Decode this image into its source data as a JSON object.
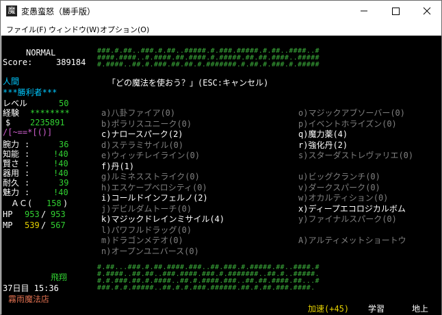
{
  "window": {
    "title": "変愚蛮怒（勝手版）",
    "icon": "app-icon"
  },
  "menu": {
    "items": [
      "ファイル(F)",
      "ウィンドウ(W)",
      "オプション(O)"
    ]
  },
  "sidebar": {
    "difficulty": "NORMAL",
    "score_label": "Score:",
    "score": "389184",
    "race": "人間",
    "title": "***勝利者***",
    "level_label": "レベル",
    "level": "50",
    "exp_label": "経験",
    "exp": "********",
    "gold_label": "$",
    "gold": "2235891",
    "equip_glyphs": "/[~==*[()]",
    "stats": [
      {
        "name": "腕力",
        "sep": ":",
        "value": "36"
      },
      {
        "name": "知能",
        "sep": ":",
        "value": "!40"
      },
      {
        "name": "賢さ",
        "sep": ":",
        "value": "!40"
      },
      {
        "name": "器用",
        "sep": ":",
        "value": "!40"
      },
      {
        "name": "耐久",
        "sep": ":",
        "value": "39"
      },
      {
        "name": "魅力",
        "sep": ":",
        "value": "!40"
      }
    ],
    "ac_label": "ＡＣ(",
    "ac": "158",
    "ac_close": ")",
    "hp_label": "HP",
    "hp": "953",
    "hp_max": "953",
    "mp_label": "MP",
    "mp": "539",
    "mp_max": "567",
    "status_fly": "飛翔",
    "date": "37日目 15:36",
    "location": "霧雨魔法店"
  },
  "prompt": "「どの魔法を使おう？」(ESC:キャンセル)",
  "spells_left": [
    {
      "text": "a)八卦ファイア(0)",
      "state": "dim"
    },
    {
      "text": "b)ポラリスユニーク(0)",
      "state": "dim"
    },
    {
      "text": "c)ナロースパーク(2)",
      "state": "on"
    },
    {
      "text": "d)ステラミサイル(0)",
      "state": "dim"
    },
    {
      "text": "e)ウィッチレイライン(0)",
      "state": "dim"
    },
    {
      "text": "f)丹(1)",
      "state": "on"
    },
    {
      "text": "g)ルミネスストライク(0)",
      "state": "dim"
    },
    {
      "text": "h)エスケープベロシティ(0)",
      "state": "dim"
    },
    {
      "text": "i)コールドインフェルノ(2)",
      "state": "on"
    },
    {
      "text": "j)デビルダムトーチ(0)",
      "state": "dim"
    },
    {
      "text": "k)マジックドレインミサイル(4)",
      "state": "on"
    },
    {
      "text": "l)パワフルドラッグ(0)",
      "state": "dim"
    },
    {
      "text": "m)ドラゴンメテオ(0)",
      "state": "dim"
    },
    {
      "text": "n)オープンユニバース(0)",
      "state": "dim"
    }
  ],
  "spells_right": [
    {
      "text": "o)マジックアブソーバー(0)",
      "state": "dim"
    },
    {
      "text": "p)イベントホライズン(0)",
      "state": "dim"
    },
    {
      "text": "q)魔力薬(4)",
      "state": "on"
    },
    {
      "text": "r)強化丹(2)",
      "state": "on"
    },
    {
      "text": "s)スターダストレヴァリエ(0)",
      "state": "dim"
    },
    {
      "text": "",
      "state": "dim"
    },
    {
      "text": "u)ビッグクランチ(0)",
      "state": "dim"
    },
    {
      "text": "v)ダークスパーク(0)",
      "state": "dim"
    },
    {
      "text": "w)オカルティション(0)",
      "state": "dim"
    },
    {
      "text": "x)ディープエコロジカルボム",
      "state": "on"
    },
    {
      "text": "y)ファイナルスパーク(0)",
      "state": "dim"
    },
    {
      "text": "",
      "state": "dim"
    },
    {
      "text": "A)アルティメットショートウ",
      "state": "dim"
    }
  ],
  "map_top": [
    "###.#.##..###.#.##..#####.#.###.#####.#.##..####..#",
    "####.####..#.####.##.####.#.#####.##.##.####..#####",
    "#.####..##.#.###.##.##.#.#######.#.##.#.###.#.#####"
  ],
  "map_bottom": [
    "#.##...###.#.##.####.###..##.###.#.#####.##..####.#",
    "#.####..##.##..###.####.###.#.#######..##.#..#####.",
    "#.#.###.##.#.####..##.#.####.###..##.##.####.##...#",
    "###.#.#.#####..##.#.#.###.######.##.#.##.###.####."
  ],
  "statusbar": {
    "speed": "加速(+45)",
    "study": "学習",
    "depth": "地上"
  },
  "colors": {
    "terminal_bg": "#000000",
    "map_green": "#3cae3c",
    "highlight_cyan": "#00c8ff",
    "stat_green": "#32d232",
    "yellow": "#e6d200",
    "orange": "#e07050"
  }
}
